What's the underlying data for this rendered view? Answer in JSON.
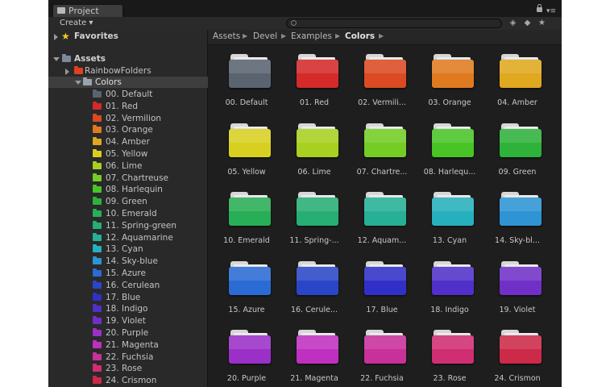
{
  "window": {
    "tab_title": "Project"
  },
  "toolbar": {
    "create_label": "Create",
    "create_arrow": "▾"
  },
  "tree": {
    "favorites": "Favorites",
    "assets": "Assets",
    "rainbow": "RainbowFolders",
    "colors": "Colors",
    "items": [
      {
        "label": "00. Default",
        "color": "#5a6470"
      },
      {
        "label": "01. Red",
        "color": "#d42a2a"
      },
      {
        "label": "02. Vermilion",
        "color": "#db4a22"
      },
      {
        "label": "03. Orange",
        "color": "#e07a20"
      },
      {
        "label": "04. Amber",
        "color": "#e0a81e"
      },
      {
        "label": "05. Yellow",
        "color": "#d8d020"
      },
      {
        "label": "06. Lime",
        "color": "#a8d020"
      },
      {
        "label": "07. Chartreuse",
        "color": "#74cc24"
      },
      {
        "label": "08. Harlequin",
        "color": "#48c426"
      },
      {
        "label": "09. Green",
        "color": "#2eb23a"
      },
      {
        "label": "10. Emerald",
        "color": "#28ae56"
      },
      {
        "label": "11. Spring-green",
        "color": "#26ae74"
      },
      {
        "label": "12. Aquamarine",
        "color": "#26b096"
      },
      {
        "label": "13. Cyan",
        "color": "#26b0be"
      },
      {
        "label": "14. Sky-blue",
        "color": "#2e94d4"
      },
      {
        "label": "15. Azure",
        "color": "#2a6cd4"
      },
      {
        "label": "16. Cerulean",
        "color": "#2a46c8"
      },
      {
        "label": "17. Blue",
        "color": "#3030c8"
      },
      {
        "label": "18. Indigo",
        "color": "#5030c8"
      },
      {
        "label": "19. Violet",
        "color": "#7030c8"
      },
      {
        "label": "20. Purple",
        "color": "#9a30c8"
      },
      {
        "label": "21. Magenta",
        "color": "#c030c0"
      },
      {
        "label": "22. Fuchsia",
        "color": "#c8309a"
      },
      {
        "label": "23. Rose",
        "color": "#d02e72"
      },
      {
        "label": "24. Crismon",
        "color": "#cc2a48"
      }
    ]
  },
  "breadcrumb": [
    "Assets",
    "Devel",
    "Examples",
    "Colors"
  ],
  "grid": {
    "labels": [
      "00. Default",
      "01. Red",
      "02. Vermili...",
      "03. Orange",
      "04. Amber",
      "05. Yellow",
      "06. Lime",
      "07. Chartre...",
      "08. Harlequ...",
      "09. Green",
      "10. Emerald",
      "11. Spring-...",
      "12. Aquam...",
      "13. Cyan",
      "14. Sky-bl...",
      "15. Azure",
      "16. Cerule...",
      "17. Blue",
      "18. Indigo",
      "19. Violet",
      "20. Purple",
      "21. Magenta",
      "22. Fuchsia",
      "23. Rose",
      "24. Crismon"
    ]
  },
  "icons": {
    "lock": "lock-icon",
    "menu": "menu-icon",
    "filter_type": "filter-by-type-icon",
    "filter_label": "filter-by-label-icon",
    "favorite": "save-favorite-icon",
    "search": "search-icon"
  },
  "colors": {
    "window_bg": "#1e1e1e",
    "sidebar_bg": "#292929",
    "rainbow_folder": "#e04020",
    "assets_folder": "#7c8a98",
    "star": "#f4c52a"
  }
}
